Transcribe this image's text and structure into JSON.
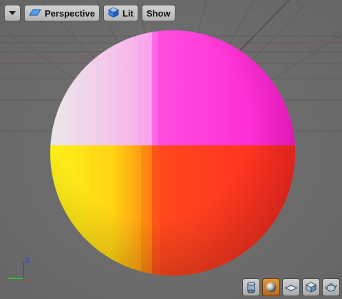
{
  "toolbar": {
    "menu_icon": "chevron-down-icon",
    "view_mode_label": "Perspective",
    "view_mode_icon": "perspective-icon",
    "lighting_label": "Lit",
    "lighting_icon": "lit-cube-icon",
    "show_label": "Show"
  },
  "axis_gizmo": {
    "z_label": "Z",
    "x_color": "#e03030",
    "y_color": "#30c030",
    "z_color": "#3050e0"
  },
  "preview_sphere": {
    "colors": {
      "top_left": "#f4e0f0",
      "top_right": "#ff2ed6",
      "bottom_left": "#ffe81a",
      "bottom_right": "#ff2a20"
    }
  },
  "preview_shape_buttons": [
    {
      "name": "cylinder-icon",
      "active": false
    },
    {
      "name": "sphere-icon",
      "active": true
    },
    {
      "name": "plane-icon",
      "active": false
    },
    {
      "name": "cube-icon",
      "active": false
    },
    {
      "name": "teapot-icon",
      "active": false
    }
  ]
}
